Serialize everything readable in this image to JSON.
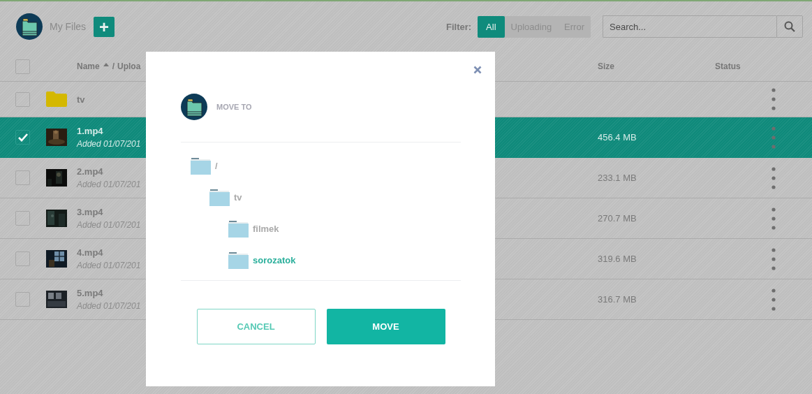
{
  "header": {
    "title": "My Files",
    "add_button": "+",
    "filter_label": "Filter:",
    "filters": [
      {
        "label": "All",
        "selected": true
      },
      {
        "label": "Uploading",
        "selected": false
      },
      {
        "label": "Error",
        "selected": false
      }
    ],
    "search": {
      "placeholder": "Search..."
    }
  },
  "table": {
    "select_all": {
      "checked": false
    },
    "column_separator": "/",
    "columns": [
      {
        "label": "Name",
        "sort_ascending": true
      },
      {
        "label": "Uploa"
      },
      {
        "label": "Size"
      },
      {
        "label": "Status"
      }
    ],
    "rows": [
      {
        "kind": "folder",
        "name": "tv",
        "checked": false,
        "selected": false
      },
      {
        "kind": "video",
        "name": "1.mp4",
        "added": "Added 01/07/201",
        "size": "456.4 MB",
        "checked": true,
        "selected": true
      },
      {
        "kind": "video",
        "name": "2.mp4",
        "added": "Added 01/07/201",
        "size": "233.1 MB",
        "checked": false,
        "selected": false
      },
      {
        "kind": "video",
        "name": "3.mp4",
        "added": "Added 01/07/201",
        "size": "270.7 MB",
        "checked": false,
        "selected": false
      },
      {
        "kind": "video",
        "name": "4.mp4",
        "added": "Added 01/07/201",
        "size": "319.6 MB",
        "checked": false,
        "selected": false
      },
      {
        "kind": "video",
        "name": "5.mp4",
        "added": "Added 01/07/201",
        "size": "316.7 MB",
        "checked": false,
        "selected": false
      }
    ]
  },
  "dialog": {
    "title": "MOVE TO",
    "tree": [
      {
        "label": "/",
        "selected": false,
        "children": [
          {
            "label": "tv",
            "selected": false,
            "children": [
              {
                "label": "filmek",
                "selected": false
              },
              {
                "label": "sorozatok",
                "selected": true
              }
            ]
          }
        ]
      }
    ],
    "buttons": [
      {
        "label": "CANCEL",
        "kind": "secondary"
      },
      {
        "label": "MOVE",
        "kind": "primary"
      }
    ]
  }
}
